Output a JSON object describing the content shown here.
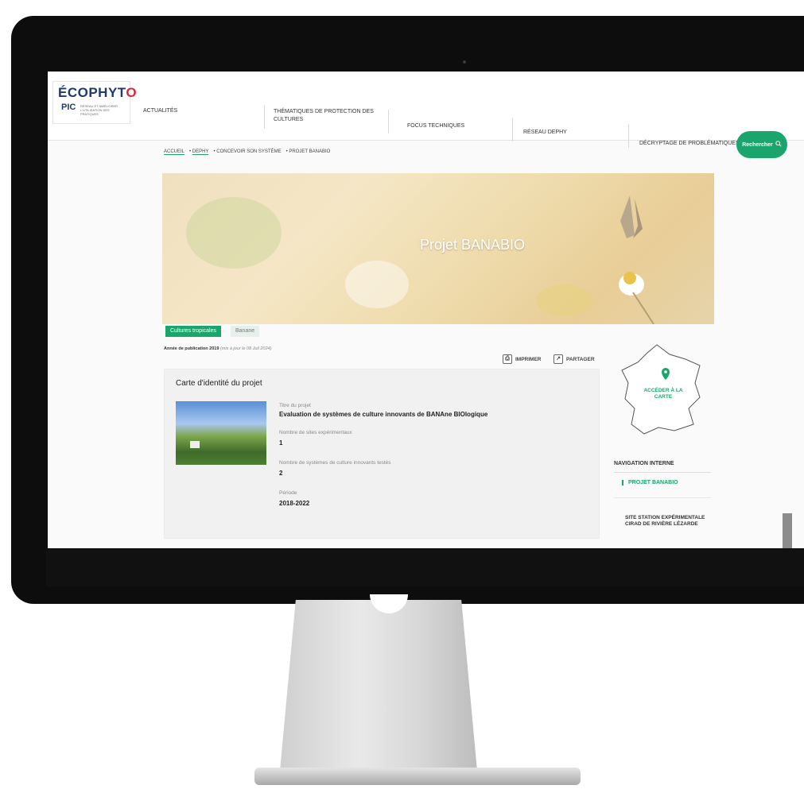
{
  "header": {
    "logo": {
      "title_part1": "ÉCOPHYT",
      "title_part2": "O",
      "subtitle": "PIC",
      "tagline": "RÉSEAU ET AMÉLIORER L'UTILISATION DES PRATIQUES"
    },
    "nav": [
      {
        "label": "ACTUALITÉS"
      },
      {
        "label": "THÉMATIQUES DE PROTECTION DES CULTURES"
      },
      {
        "label": "FOCUS TECHNIQUES"
      },
      {
        "label": "RÉSEAU DEPHY"
      },
      {
        "label": "DÉCRYPTAGE DE PROBLÉMATIQUES"
      }
    ],
    "search_label": "Rechercher"
  },
  "breadcrumb": [
    "ACCUEIL",
    "DEPHY",
    "CONCEVOIR SON SYSTÈME",
    "PROJET BANABIO"
  ],
  "banner": {
    "title": "Projet BANABIO"
  },
  "tags": [
    "Cultures tropicales",
    "Banane"
  ],
  "publication": {
    "label": "Année de publication 2019",
    "updated": "(mis à jour le 08 Juil 2024)"
  },
  "actions": {
    "print": "IMPRIMER",
    "share": "PARTAGER"
  },
  "card": {
    "title": "Carte d'identité du projet",
    "fields": [
      {
        "label": "Titre du projet",
        "value": "Evaluation de systèmes de culture innovants de BANAne BIOlogique"
      },
      {
        "label": "Nombre de sites expérimentaux",
        "value": "1"
      },
      {
        "label": "Nombre de systèmes de culture innovants testés",
        "value": "2"
      },
      {
        "label": "Période",
        "value": "2018-2022"
      }
    ]
  },
  "sidebar": {
    "map_cta": "ACCÉDER À LA CARTE",
    "nav_title": "NAVIGATION INTERNE",
    "nav_items": [
      "PROJET BANABIO",
      "SITE STATION EXPÉRIMENTALE CIRAD DE RIVIÈRE LÉZARDE"
    ]
  },
  "colors": {
    "accent": "#1aa56c",
    "brand_blue": "#1f3a6b",
    "brand_red": "#d9263a"
  },
  "icons": [
    "search-icon",
    "print-icon",
    "share-icon",
    "map-pin-icon"
  ]
}
